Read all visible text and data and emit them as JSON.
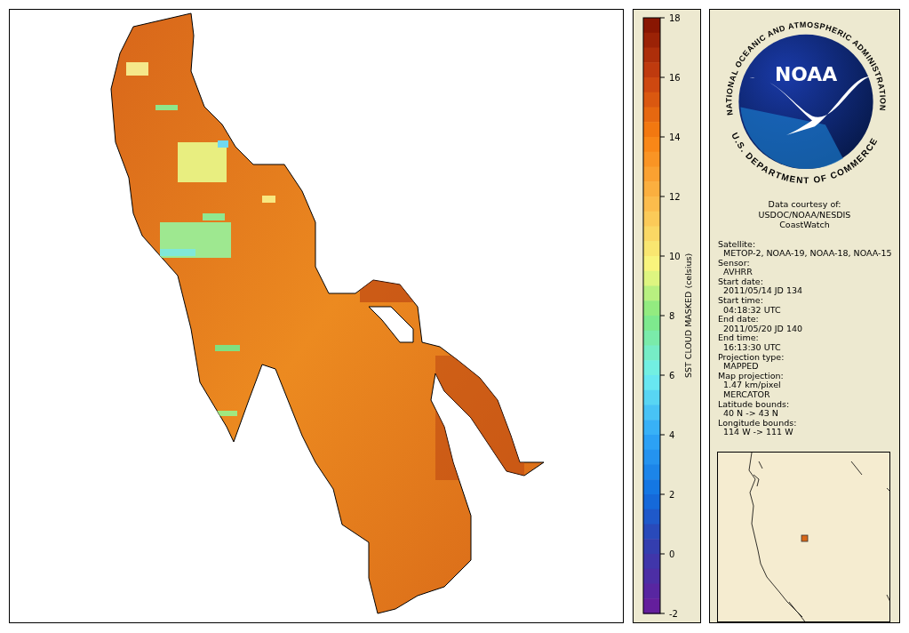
{
  "colorbar": {
    "title": "SST CLOUD MASKED (celsius)",
    "ticks": [
      "18",
      "16",
      "14",
      "12",
      "10",
      "8",
      "6",
      "4",
      "2",
      "0",
      "-2"
    ]
  },
  "logo": {
    "top_text": "NATIONAL OCEANIC AND ATMOSPHERIC ADMINISTRATION",
    "bottom_text": "U.S. DEPARTMENT OF COMMERCE",
    "wordmark": "NOAA"
  },
  "credit": [
    "Data courtesy of:",
    "USDOC/NOAA/NESDIS",
    "CoastWatch"
  ],
  "fields": [
    {
      "label": "Satellite:",
      "values": [
        "METOP-2, NOAA-19, NOAA-18, NOAA-15"
      ]
    },
    {
      "label": "Sensor:",
      "values": [
        "AVHRR"
      ]
    },
    {
      "label": "Start date:",
      "values": [
        "2011/05/14 JD 134"
      ]
    },
    {
      "label": "Start time:",
      "values": [
        "04:18:32 UTC"
      ]
    },
    {
      "label": "End date:",
      "values": [
        "2011/05/20 JD 140"
      ]
    },
    {
      "label": "End time:",
      "values": [
        "16:13:30 UTC"
      ]
    },
    {
      "label": "Projection type:",
      "values": [
        "MAPPED"
      ]
    },
    {
      "label": "Map projection:",
      "values": [
        "1.47 km/pixel",
        "MERCATOR"
      ]
    },
    {
      "label": "Latitude bounds:",
      "values": [
        "40 N -> 43 N"
      ]
    },
    {
      "label": "Longitude bounds:",
      "values": [
        "114 W -> 111 W"
      ]
    }
  ]
}
